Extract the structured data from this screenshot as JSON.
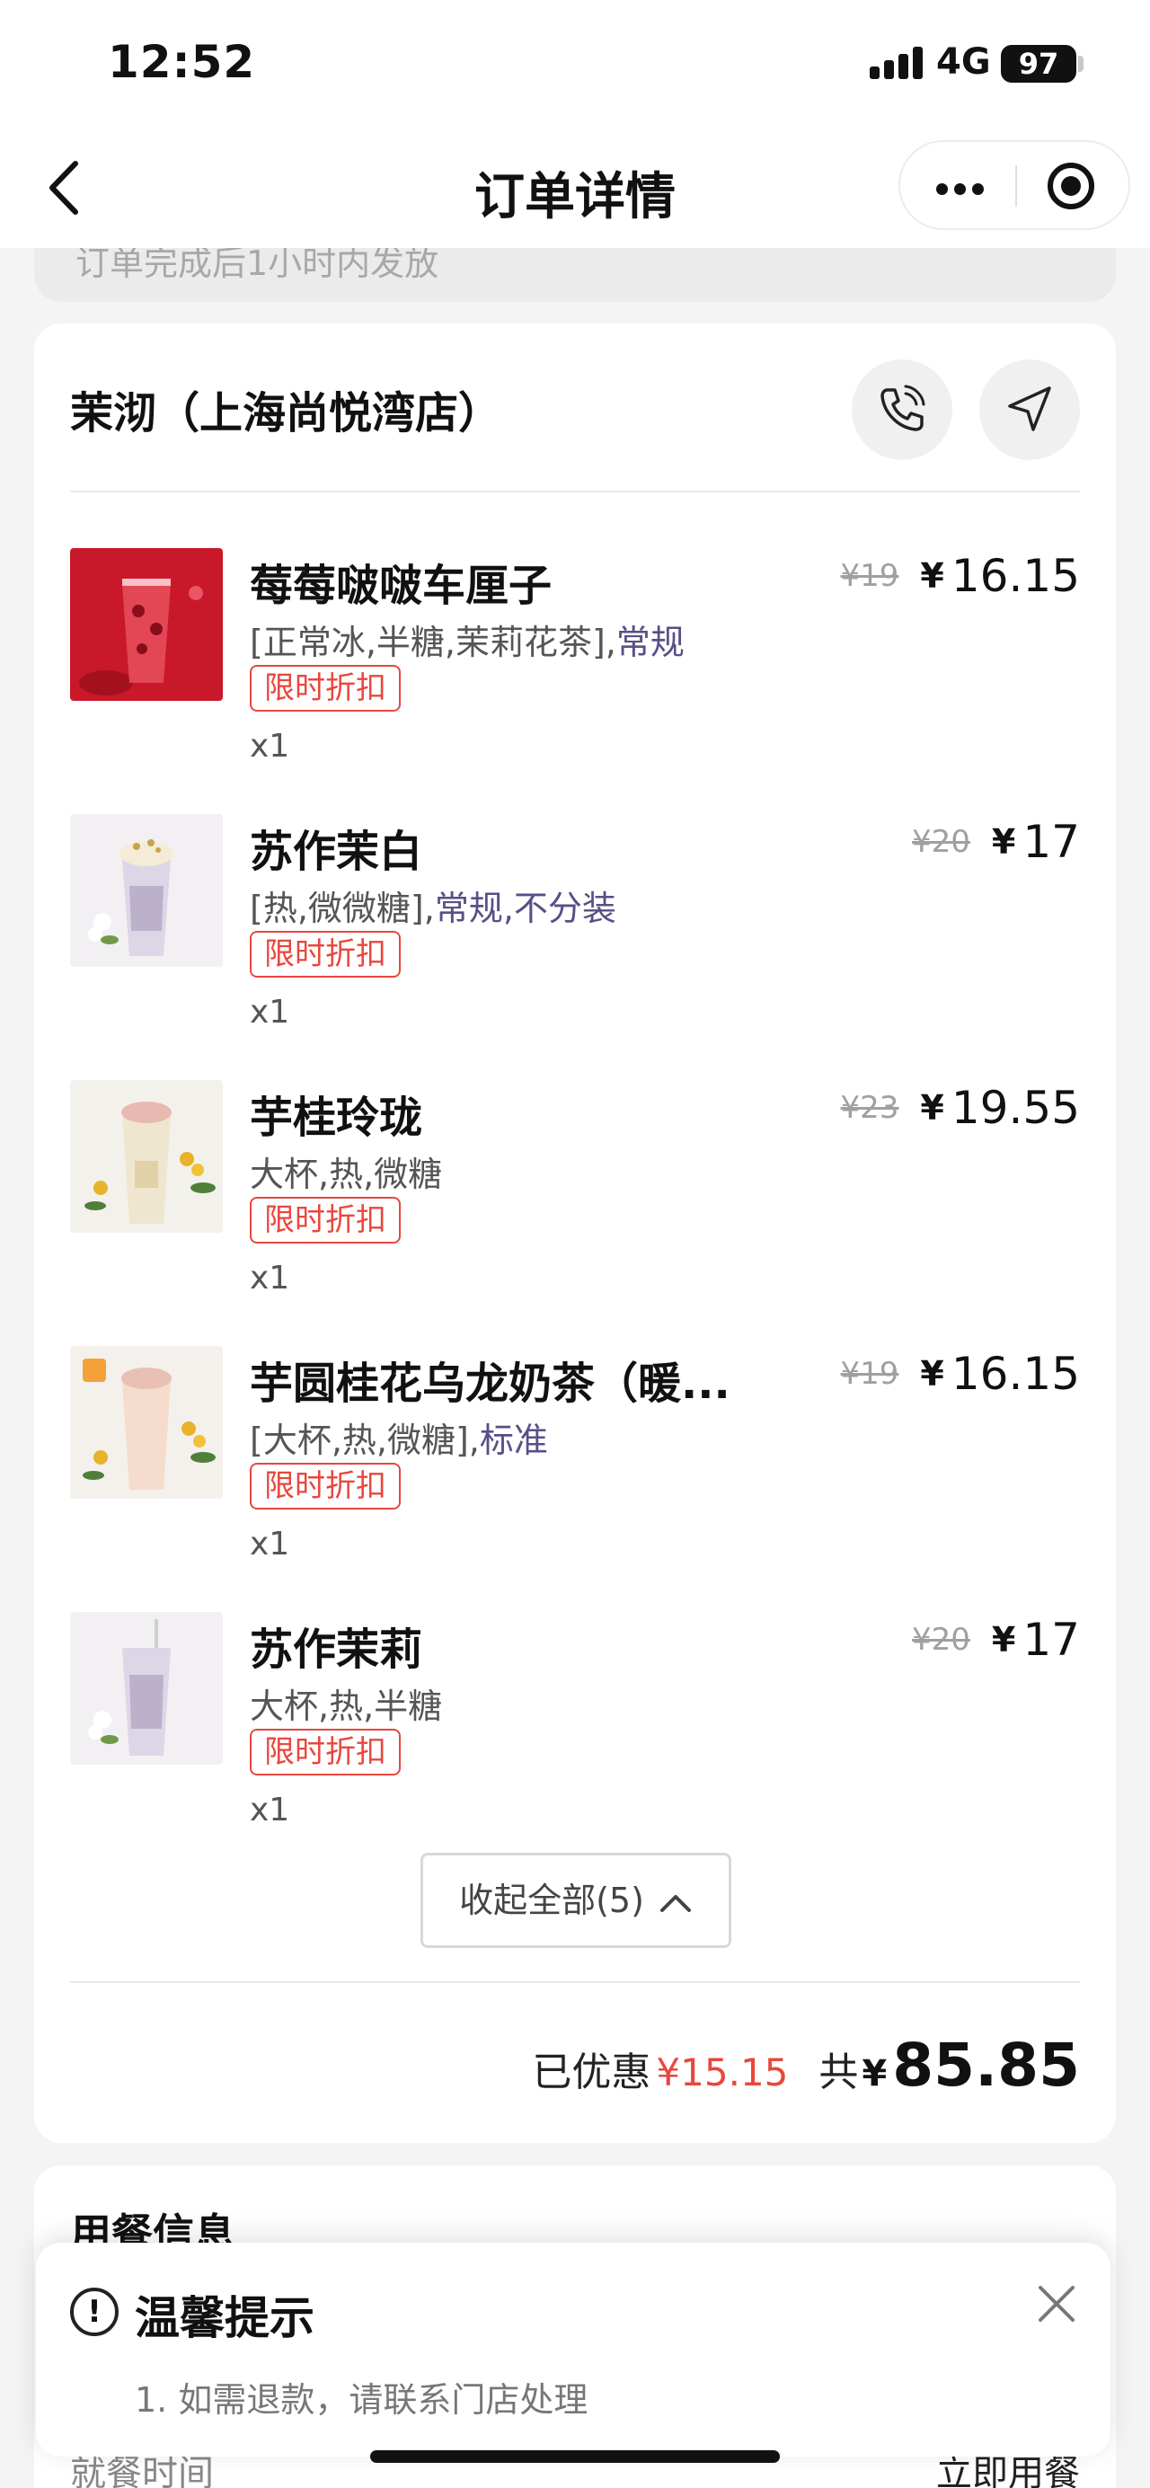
{
  "status_bar": {
    "time": "12:52",
    "network": "4G",
    "battery": "97"
  },
  "nav": {
    "title": "订单详情"
  },
  "prev_note": "订单完成后1小时内发放",
  "store": {
    "name": "茉沏（上海尚悦湾店）"
  },
  "items": [
    {
      "name": "莓莓啵啵车厘子",
      "spec": "[正常冰,半糖,茉莉花茶],",
      "spec_alt": "常规",
      "badge": "限时折扣",
      "qty": "x1",
      "orig": "¥19",
      "currency": "¥",
      "price": "16.15"
    },
    {
      "name": "苏作茉白",
      "spec": "[热,微微糖],",
      "spec_alt": "常规,不分装",
      "badge": "限时折扣",
      "qty": "x1",
      "orig": "¥20",
      "currency": "¥",
      "price": "17"
    },
    {
      "name": "芋桂玲珑",
      "spec": "大杯,热,微糖",
      "spec_alt": "",
      "badge": "限时折扣",
      "qty": "x1",
      "orig": "¥23",
      "currency": "¥",
      "price": "19.55"
    },
    {
      "name": "芋圆桂花乌龙奶茶（暖...",
      "spec": "[大杯,热,微糖],",
      "spec_alt": "标准",
      "badge": "限时折扣",
      "qty": "x1",
      "orig": "¥19",
      "currency": "¥",
      "price": "16.15"
    },
    {
      "name": "苏作茉莉",
      "spec": "大杯,热,半糖",
      "spec_alt": "",
      "badge": "限时折扣",
      "qty": "x1",
      "orig": "¥20",
      "currency": "¥",
      "price": "17"
    }
  ],
  "collapse_label": "收起全部(5)",
  "summary": {
    "discount_label": "已优惠",
    "discount": "¥15.15",
    "total_label": "共",
    "total_currency": "¥",
    "total": "85.85"
  },
  "dining": {
    "title": "用餐信息",
    "row_label": "就餐时间",
    "row_value": "立即用餐"
  },
  "tip": {
    "title": "温馨提示",
    "line": "1. 如需退款，请联系门店处理"
  },
  "colors": {
    "accent_red": "#e8473e",
    "spec_purple": "#5a4e86"
  }
}
